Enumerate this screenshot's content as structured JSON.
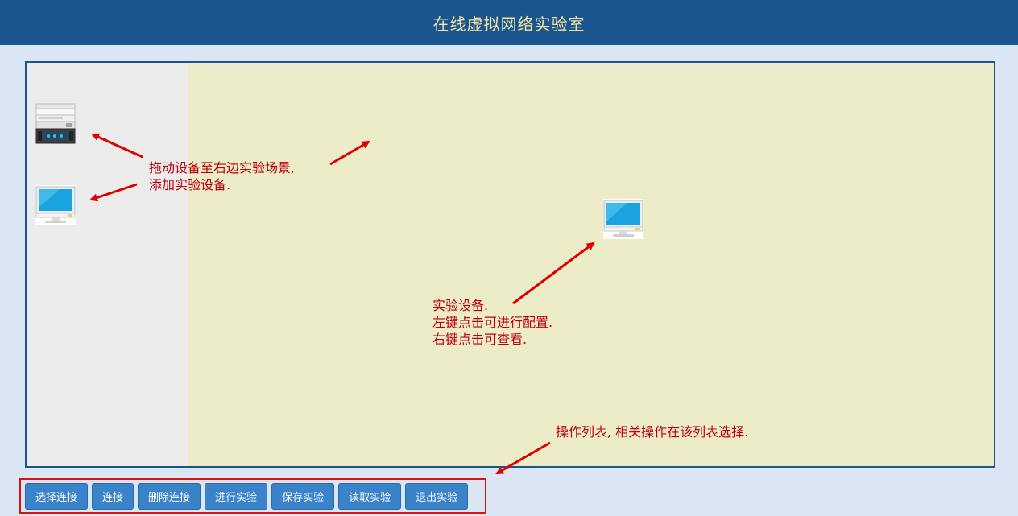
{
  "header": {
    "title": "在线虚拟网络实验室"
  },
  "palette": {
    "items": [
      {
        "icon": "router-icon"
      },
      {
        "icon": "computer-icon"
      }
    ]
  },
  "scene": {
    "devices": [
      {
        "icon": "computer-icon"
      }
    ]
  },
  "annotations": {
    "drag": {
      "line1": "拖动设备至右边实验场景,",
      "line2": "添加实验设备."
    },
    "device": {
      "line1": "实验设备.",
      "line2": "左键点击可进行配置.",
      "line3": "右键点击可查看."
    },
    "ops": {
      "line1": "操作列表, 相关操作在该列表选择."
    }
  },
  "toolbar": {
    "buttons": [
      {
        "label": "选择连接"
      },
      {
        "label": "连接"
      },
      {
        "label": "删除连接"
      },
      {
        "label": "进行实验"
      },
      {
        "label": "保存实验"
      },
      {
        "label": "读取实验"
      },
      {
        "label": "退出实验"
      }
    ]
  },
  "colors": {
    "header_bg": "#1b5590",
    "header_text": "#f3e4a2",
    "page_bg": "#dae6f3",
    "scene_bg": "#ececc9",
    "palette_bg": "#ececec",
    "annotation": "#c0000c",
    "button_bg": "#3a83c9",
    "toolbar_border": "#dd1111"
  }
}
